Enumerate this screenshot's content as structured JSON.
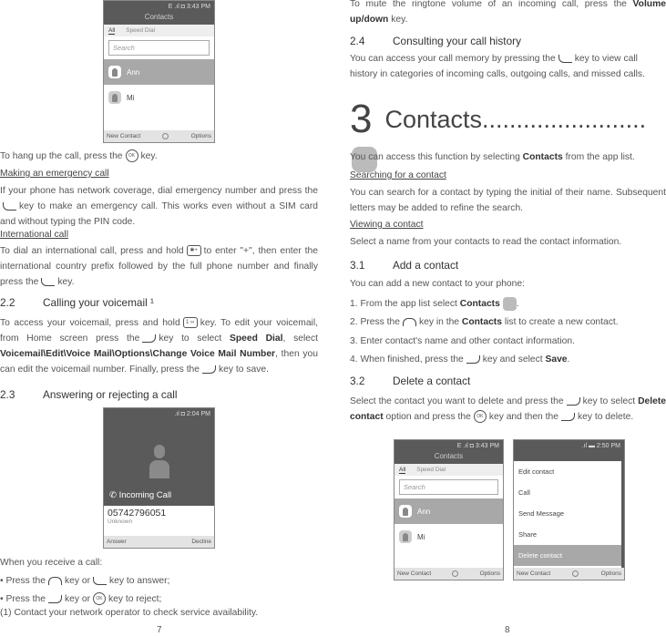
{
  "left_page": {
    "phone_contacts": {
      "status": "E .ıl ◘ 3:43 PM",
      "title": "Contacts",
      "tab_all": "All",
      "tab_speed": "Speed Dial",
      "search_placeholder": "Search",
      "contacts": [
        "Ann",
        "Mi"
      ],
      "soft_left": "New Contact",
      "soft_right": "Options"
    },
    "hang_up": {
      "a": "To hang up the call, press the",
      "b": "key."
    },
    "emergency": {
      "heading": "Making an emergency call",
      "a": "If your phone has network coverage, dial emergency number and press the",
      "b": "key to make an emergency call. This works even without a SIM card and without typing the PIN code."
    },
    "international": {
      "heading": "International call",
      "a": "To dial an international call, press and hold",
      "b": "to enter \"+\", then enter the international country prefix followed by the full phone number and finally press the",
      "c": "key."
    },
    "s22": {
      "num": "2.2",
      "title": "Calling your voicemail ¹",
      "a": "To access your voicemail, press and hold",
      "b": "key. To edit your voicemail, from Home screen press the",
      "c": "key to select",
      "d": "Speed Dial",
      "e": ", select",
      "f": "Voicemail\\Edit\\Voice Mail\\Options\\Change Voice Mail Number",
      "g": ", then you can edit the voicemail number. Finally, press the",
      "h": "key to save."
    },
    "s23": {
      "num": "2.3",
      "title": "Answering or rejecting a call"
    },
    "phone_incoming": {
      "status": ".ıl ◘ 2:04 PM",
      "label": "Incoming Call",
      "number": "05742796051",
      "sub": "Unknown",
      "soft_left": "Answer",
      "soft_right": "Decline"
    },
    "receive": "When you receive a call:",
    "bullet1": {
      "a": "• Press the",
      "b": "key or",
      "c": "key to answer;"
    },
    "bullet2": {
      "a": "• Press the",
      "b": "key or",
      "c": "key to reject;"
    },
    "footnote": "(1) Contact your network operator to check service availability.",
    "page_number": "7"
  },
  "right_page": {
    "mute": {
      "a": "To mute the ringtone volume of an incoming call, press the",
      "b": "Volume up/down",
      "c": "key."
    },
    "s24": {
      "num": "2.4",
      "title": "Consulting your call history",
      "a": "You can access your call memory by pressing the",
      "b": "key to view call history in categories of incoming calls, outgoing calls, and missed calls."
    },
    "ch3": {
      "num": "3",
      "title": "Contacts........................"
    },
    "intro": {
      "a": "You can access this function by selecting",
      "b": "Contacts",
      "c": "from the app list."
    },
    "searching": {
      "heading": "Searching for a contact",
      "text": "You can search for a contact by typing the initial of their name. Subsequent letters may be added to refine the search."
    },
    "viewing": {
      "heading": "Viewing a contact",
      "text": "Select a name from your contacts to read the contact information."
    },
    "s31": {
      "num": "3.1",
      "title": "Add a contact",
      "intro": "You can add a new contact to your phone:",
      "step1": {
        "a": "1. From the app list select",
        "b": "Contacts",
        "c": "."
      },
      "step2": {
        "a": "2. Press the",
        "b": "key in the",
        "c": "Contacts",
        "d": "list to create a new contact."
      },
      "step3": "3. Enter contact's name and other contact information.",
      "step4": {
        "a": "4. When finished, press the",
        "b": "key and select",
        "c": "Save",
        "d": "."
      }
    },
    "s32": {
      "num": "3.2",
      "title": "Delete a contact",
      "a": "Select the contact you want to delete and press the",
      "b": "key to select",
      "c": "Delete contact",
      "d": "option and press the",
      "e": "key and then the",
      "f": "key to delete."
    },
    "phone_options": {
      "status": ".ıl ▬ 2:50 PM",
      "items": [
        "Edit contact",
        "Call",
        "Send Message",
        "Share",
        "Delete contact"
      ],
      "soft_left": "New Contact",
      "soft_right": "Options"
    },
    "page_number": "8"
  },
  "icons": {
    "ok_key": "OK",
    "star_key": "✱+",
    "one_key": "1 ∞"
  }
}
